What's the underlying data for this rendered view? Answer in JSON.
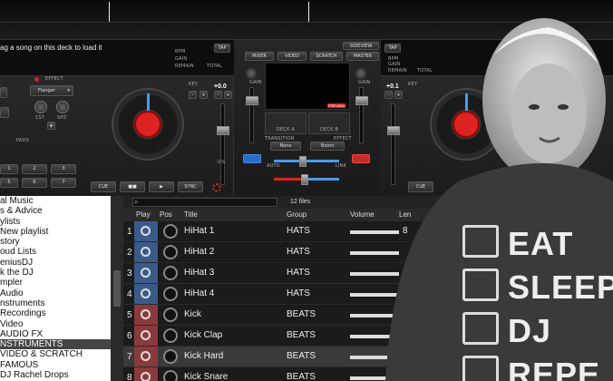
{
  "deck_left": {
    "drag_hint": "ag a song on this deck to load it",
    "effect_label": "EFFECT",
    "effect_value": "Flanger",
    "effect_knobs": [
      "1ST",
      "SPD"
    ],
    "key_label": "KEY",
    "pitch_value": "+0.0",
    "pitch_range": "-1%",
    "pads_label": "PADS",
    "pad_numbers": [
      "1",
      "2",
      "3",
      "4",
      "5",
      "6",
      "7",
      "8"
    ],
    "transport": [
      "CUE",
      "■■",
      "▶",
      "SYNC"
    ],
    "tap": "TAP",
    "info_labels": [
      "BPM",
      "GAIN",
      "REMAIN",
      "TOTAL"
    ]
  },
  "deck_right": {
    "tap": "TAP",
    "info_labels": [
      "BPM",
      "GAIN",
      "REMAIN",
      "TOTAL"
    ],
    "pitch_value": "+0.1",
    "key_label": "KEY",
    "transport": [
      "CUE"
    ]
  },
  "mixer": {
    "tabs": [
      "MIXER",
      "VIDEO",
      "SCRATCH",
      "MASTER"
    ],
    "sidebar_btn": "SIDEVIEW",
    "gain_left": "GAIN",
    "gain_right": "GAIN",
    "deck_a": "DECK A",
    "deck_b": "DECK B",
    "transition_label": "TRANSITION",
    "transition_value": "None",
    "effect_label": "EFFECT",
    "effect_value": "Boom",
    "auto_label": "AUTO",
    "link_label": "LINK",
    "preview_badge": "PREVIEW"
  },
  "browser": {
    "file_count": "12 files",
    "columns": [
      "Play",
      "Pos",
      "Title",
      "Group",
      "Volume",
      "Len"
    ],
    "rows": [
      {
        "num": "1",
        "title": "HiHat 1",
        "group": "HATS",
        "vol": 0.9,
        "len": "8",
        "type": "hat"
      },
      {
        "num": "2",
        "title": "HiHat 2",
        "group": "HATS",
        "vol": 0.9,
        "len": "",
        "type": "hat"
      },
      {
        "num": "3",
        "title": "HiHat 3",
        "group": "HATS",
        "vol": 0.9,
        "len": "",
        "type": "hat"
      },
      {
        "num": "4",
        "title": "HiHat 4",
        "group": "HATS",
        "vol": 0.9,
        "len": "",
        "type": "hat"
      },
      {
        "num": "5",
        "title": "Kick",
        "group": "BEATS",
        "vol": 0.9,
        "len": "",
        "type": "beat"
      },
      {
        "num": "6",
        "title": "Kick Clap",
        "group": "BEATS",
        "vol": 0.9,
        "len": "",
        "type": "beat"
      },
      {
        "num": "7",
        "title": "Kick Hard",
        "group": "BEATS",
        "vol": 0.9,
        "len": "",
        "type": "beat",
        "selected": true
      },
      {
        "num": "8",
        "title": "Kick Snare",
        "group": "BEATS",
        "vol": 0.9,
        "len": "",
        "type": "beat"
      }
    ]
  },
  "folders": [
    "al Music",
    "s & Advice",
    "ylists",
    "New playlist",
    "story",
    "oud Lists",
    "eniusDJ",
    "k the DJ",
    "mpler",
    "Audio",
    "nstruments",
    "Recordings",
    "Video",
    "AUDIO FX",
    "NSTRUMENTS",
    "VIDEO & SCRATCH",
    "FAMOUS",
    "DJ Rachel Drops"
  ],
  "selected_folder_index": 14,
  "shirt": {
    "lines": [
      "EAT",
      "SLEEP",
      "DJ",
      "REPE"
    ]
  },
  "colors": {
    "accent_red": "#d22222",
    "accent_blue": "#3aa0ff",
    "hat_play_bg": "#3a5a8a",
    "beat_play_bg": "#8a3a3a"
  }
}
